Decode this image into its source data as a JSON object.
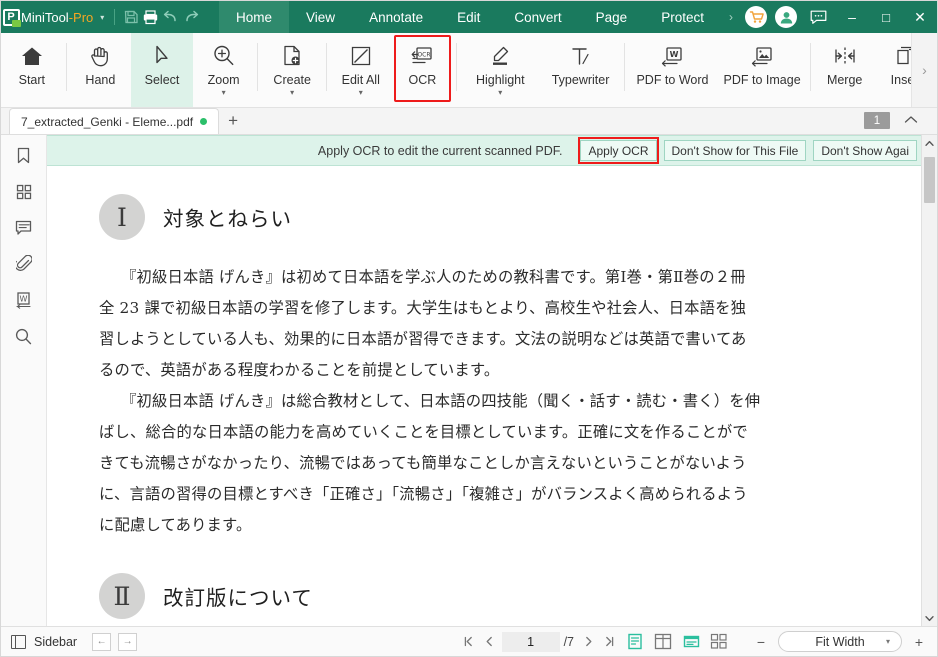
{
  "titlebar": {
    "brand_main": "MiniTool",
    "brand_accent": "-Pro",
    "caret": "▾",
    "icons": [
      {
        "name": "save-icon",
        "glyph": "save"
      },
      {
        "name": "print-icon",
        "glyph": "print"
      },
      {
        "name": "undo-icon",
        "glyph": "undo"
      },
      {
        "name": "redo-icon",
        "glyph": "redo"
      }
    ],
    "tabs": [
      {
        "label": "Home",
        "active": true
      },
      {
        "label": "View",
        "active": false
      },
      {
        "label": "Annotate",
        "active": false
      },
      {
        "label": "Edit",
        "active": false
      },
      {
        "label": "Convert",
        "active": false
      },
      {
        "label": "Page",
        "active": false
      },
      {
        "label": "Protect",
        "active": false
      }
    ],
    "overflow_glyph": "›",
    "cart_icon": "cart-icon",
    "account_icon": "account-icon",
    "feedback_icon": "feedback-icon",
    "minimize": "–",
    "maximize": "□",
    "close": "✕",
    "bg_color": "#1a7a5e",
    "active_tab_color": "#2f8a6d"
  },
  "ribbon": {
    "items": [
      {
        "label": "Start",
        "icon": "home-icon",
        "caret": false,
        "selected": false,
        "boxed": false
      },
      {
        "label": "Hand",
        "icon": "hand-icon",
        "caret": false,
        "selected": false,
        "boxed": false
      },
      {
        "label": "Select",
        "icon": "cursor-icon",
        "caret": false,
        "selected": true,
        "boxed": false
      },
      {
        "label": "Zoom",
        "icon": "zoom-icon",
        "caret": true,
        "selected": false,
        "boxed": false
      },
      {
        "label": "Create",
        "icon": "create-pdf-icon",
        "caret": true,
        "selected": false,
        "boxed": false
      },
      {
        "label": "Edit All",
        "icon": "edit-all-icon",
        "caret": true,
        "selected": false,
        "boxed": false
      },
      {
        "label": "OCR",
        "icon": "ocr-icon",
        "caret": false,
        "selected": false,
        "boxed": true
      },
      {
        "label": "Highlight",
        "icon": "highlight-icon",
        "caret": true,
        "selected": false,
        "boxed": false
      },
      {
        "label": "Typewriter",
        "icon": "typewriter-icon",
        "caret": false,
        "selected": false,
        "boxed": false
      },
      {
        "label": "PDF to Word",
        "icon": "pdf-to-word-icon",
        "caret": false,
        "selected": false,
        "boxed": false
      },
      {
        "label": "PDF to Image",
        "icon": "pdf-to-image-icon",
        "caret": false,
        "selected": false,
        "boxed": false
      },
      {
        "label": "Merge",
        "icon": "merge-icon",
        "caret": false,
        "selected": false,
        "boxed": false
      },
      {
        "label": "Insert",
        "icon": "insert-icon",
        "caret": false,
        "selected": false,
        "boxed": false
      }
    ],
    "expand_glyph": "›",
    "highlight_color": "#ee1b1b",
    "selected_bg": "#ddf2e9"
  },
  "doctabs": {
    "tab_title": "7_extracted_Genki - Eleme...pdf",
    "new_tab_glyph": "+"
  },
  "notice": {
    "message": "Apply OCR to edit the current scanned PDF.",
    "apply_label": "Apply OCR",
    "dont_show_file_label": "Don't Show for This File",
    "dont_show_again_label": "Don't Show Agai",
    "badge_count": "1",
    "collapse_glyph": "⌃",
    "bg_color": "#ddf3ea"
  },
  "rail": {
    "items": [
      {
        "name": "bookmark-icon"
      },
      {
        "name": "thumbnails-icon"
      },
      {
        "name": "comment-icon"
      },
      {
        "name": "attachment-icon"
      },
      {
        "name": "word-icon"
      },
      {
        "name": "search-icon"
      }
    ]
  },
  "document": {
    "section1": {
      "number": "Ⅰ",
      "title": "対象とねらい",
      "lines": [
        "『初級日本語 げんき』は初めて日本語を学ぶ人のための教科書です。第Ⅰ巻・第Ⅱ巻の２冊",
        "全 23 課で初級日本語の学習を修了します。大学生はもとより、高校生や社会人、日本語を独",
        "習しようとしている人も、効果的に日本語が習得できます。文法の説明などは英語で書いてあ",
        "るので、英語がある程度わかることを前提としています。"
      ],
      "lines2": [
        "『初級日本語 げんき』は総合教材として、日本語の四技能（聞く・話す・読む・書く）を伸",
        "ばし、総合的な日本語の能力を高めていくことを目標としています。正確に文を作ることがで",
        "きても流暢さがなかったり、流暢ではあっても簡単なことしか言えないということがないよう",
        "に、言語の習得の目標とすべき「正確さ」「流暢さ」「複雑さ」がバランスよく高められるよう",
        "に配慮してあります。"
      ]
    },
    "section2": {
      "number": "Ⅱ",
      "title": "改訂版について"
    }
  },
  "statusbar": {
    "sidebar_label": "Sidebar",
    "prev_pane_glyph": "←",
    "next_pane_glyph": "→",
    "first_page_glyph": "⏮",
    "prev_page_glyph": "‹",
    "page_value": "1",
    "page_total": "/7",
    "next_page_glyph": "›",
    "last_page_glyph": "⏭",
    "view_modes": [
      {
        "name": "single-page-view-icon",
        "active": true
      },
      {
        "name": "two-page-view-icon",
        "active": false
      },
      {
        "name": "continuous-scroll-icon",
        "active": true
      },
      {
        "name": "grid-view-icon",
        "active": false
      }
    ],
    "zoom_out_glyph": "−",
    "zoom_in_glyph": "+",
    "zoom_value": "Fit Width",
    "zoom_caret": "▾",
    "accent_color": "#2bbf9e"
  }
}
